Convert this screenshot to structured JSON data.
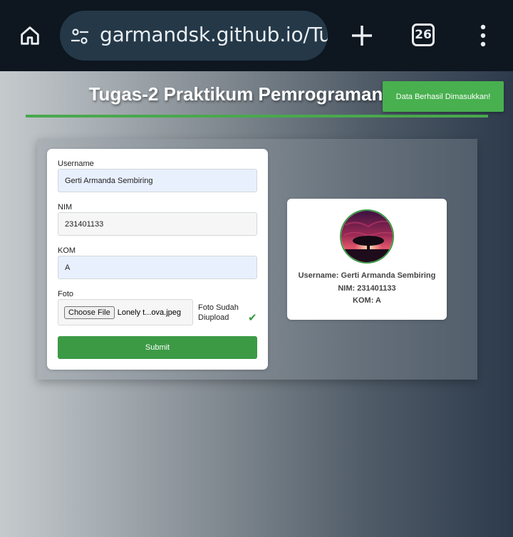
{
  "browser": {
    "url": "garmandsk.github.io/Tugas",
    "tab_count": "26"
  },
  "page": {
    "title": "Tugas-2 Praktikum Pemrograman",
    "toast": "Data Berhasil Dimasukkan!"
  },
  "form": {
    "username_label": "Username",
    "username_value": "Gerti Armanda Sembiring",
    "nim_label": "NIM",
    "nim_value": "231401133",
    "kom_label": "KOM",
    "kom_value": "A",
    "foto_label": "Foto",
    "file_button": "Choose File",
    "file_name": "Lonely t...ova.jpeg",
    "upload_status_line1": "Foto Sudah",
    "upload_status_line2": "Diupload",
    "upload_check": "✔",
    "submit_label": "Submit"
  },
  "profile": {
    "username_line": "Username: Gerti Armanda Sembiring",
    "nim_line": "NIM: 231401133",
    "kom_line": "KOM: A"
  },
  "colors": {
    "accent_green": "#3c9a45",
    "toast_green": "#48b04f",
    "chrome_bg": "#0e161f",
    "urlbar_bg": "#243848"
  },
  "icons": [
    "home-icon",
    "tune-icon",
    "plus-icon",
    "tabs-icon",
    "more-vert-icon",
    "check-icon"
  ]
}
